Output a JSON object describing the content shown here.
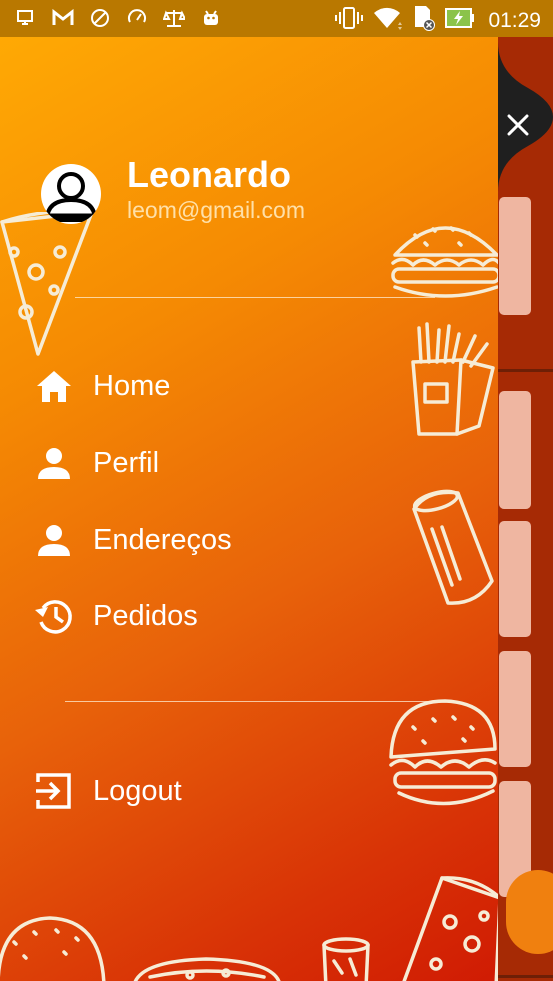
{
  "status_bar": {
    "time": "01:29",
    "left_icons": [
      "screen-cast-icon",
      "gmail-icon",
      "do-not-disturb-icon",
      "speed-icon",
      "balance-icon",
      "android-icon"
    ],
    "right_icons": [
      "vibrate-icon",
      "wifi-icon",
      "sd-card-icon",
      "battery-charging-icon"
    ]
  },
  "profile": {
    "name": "Leonardo",
    "email": "leom@gmail.com"
  },
  "menu": {
    "items": [
      {
        "label": "Home",
        "icon": "home-icon"
      },
      {
        "label": "Perfil",
        "icon": "person-icon"
      },
      {
        "label": "Endereços",
        "icon": "person-icon"
      },
      {
        "label": "Pedidos",
        "icon": "history-icon"
      }
    ],
    "logout": {
      "label": "Logout",
      "icon": "logout-icon"
    }
  },
  "colors": {
    "gradient_top": "#ffa904",
    "gradient_bottom": "#d01b03",
    "status_bar": "#b97800",
    "close_tab": "#1f1f1f",
    "fab": "#f0800f"
  }
}
